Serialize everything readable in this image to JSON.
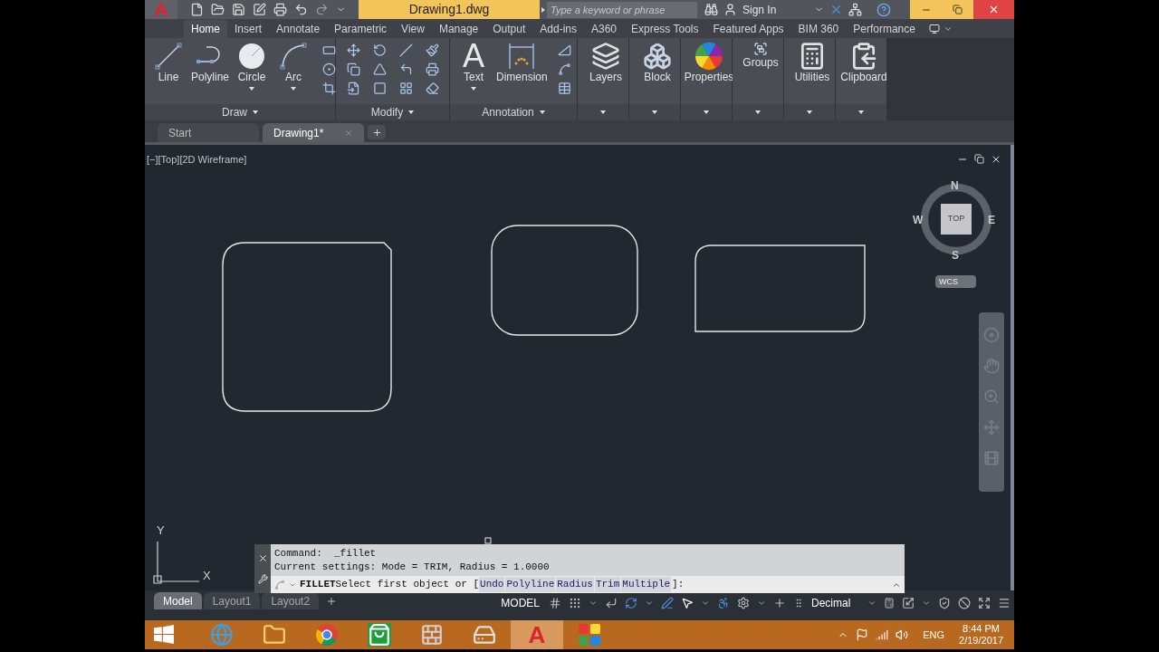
{
  "title_bar": {
    "app_button": "A",
    "document": "Drawing1.dwg",
    "search": {
      "placeholder": "Type a keyword or phrase"
    },
    "sign_in": "Sign In"
  },
  "ribbon_tabs": [
    {
      "label": "Home",
      "selected": true
    },
    {
      "label": "Insert",
      "selected": false
    },
    {
      "label": "Annotate",
      "selected": false
    },
    {
      "label": "Parametric",
      "selected": false
    },
    {
      "label": "View",
      "selected": false
    },
    {
      "label": "Manage",
      "selected": false
    },
    {
      "label": "Output",
      "selected": false
    },
    {
      "label": "Add-ins",
      "selected": false
    },
    {
      "label": "A360",
      "selected": false
    },
    {
      "label": "Express Tools",
      "selected": false
    },
    {
      "label": "Featured Apps",
      "selected": false
    },
    {
      "label": "BIM 360",
      "selected": false
    },
    {
      "label": "Performance",
      "selected": false
    }
  ],
  "ribbon_panels": [
    {
      "kind": "group",
      "title": "Draw",
      "tools": [
        {
          "label": "Line",
          "menu": false
        },
        {
          "label": "Polyline",
          "menu": false
        },
        {
          "label": "Circle",
          "menu": true
        },
        {
          "label": "Arc",
          "menu": true
        }
      ]
    },
    {
      "kind": "group",
      "title": "Modify"
    },
    {
      "kind": "group",
      "title": "Annotation",
      "tools": [
        {
          "label": "Text",
          "glyph": "A",
          "menu": true
        },
        {
          "label": "Dimension",
          "menu": false
        }
      ]
    },
    {
      "kind": "single",
      "tools": [
        {
          "label": "Layers"
        }
      ]
    },
    {
      "kind": "single",
      "tools": [
        {
          "label": "Block"
        }
      ]
    },
    {
      "kind": "single",
      "tools": [
        {
          "label": "Properties"
        }
      ]
    },
    {
      "kind": "single",
      "tools": [
        {
          "label": "Groups"
        }
      ]
    },
    {
      "kind": "single",
      "tools": [
        {
          "label": "Utilities"
        }
      ]
    },
    {
      "kind": "single",
      "tools": [
        {
          "label": "Clipboard"
        }
      ]
    }
  ],
  "file_tabs": [
    {
      "label": "Start",
      "selected": false
    },
    {
      "label": "Drawing1*",
      "selected": true
    }
  ],
  "viewport": {
    "label": "[−][Top][2D Wireframe]",
    "viewcube": {
      "face": "TOP",
      "north": "N",
      "south": "S",
      "east": "E",
      "west": "W",
      "ucs_menu": "WCS"
    },
    "ucs": {
      "x": "X",
      "y": "Y"
    }
  },
  "command_line": {
    "history": [
      "Command:  _fillet",
      "Current settings: Mode = TRIM, Radius = 1.0000"
    ],
    "command": "FILLET",
    "prompt": "Select first object or [",
    "options": [
      "Undo",
      "Polyline",
      "Radius",
      "Trim",
      "Multiple"
    ],
    "suffix": "]:"
  },
  "layout_tabs": [
    {
      "label": "Model",
      "selected": true
    },
    {
      "label": "Layout1",
      "selected": false
    },
    {
      "label": "Layout2",
      "selected": false
    }
  ],
  "status_bar": {
    "space": "MODEL",
    "units": "Decimal"
  },
  "taskbar": {
    "apps": [
      {
        "kind": "browser-e",
        "selected": false
      },
      {
        "kind": "folder",
        "selected": false
      },
      {
        "kind": "chrome",
        "selected": false
      },
      {
        "kind": "store",
        "selected": false
      },
      {
        "kind": "bricks",
        "selected": false
      },
      {
        "kind": "drive",
        "selected": false
      },
      {
        "kind": "cad",
        "glyph": "A",
        "selected": true
      },
      {
        "kind": "tiles",
        "selected": false
      }
    ],
    "language": "ENG",
    "time": "8:44 PM",
    "date": "2/19/2017"
  }
}
